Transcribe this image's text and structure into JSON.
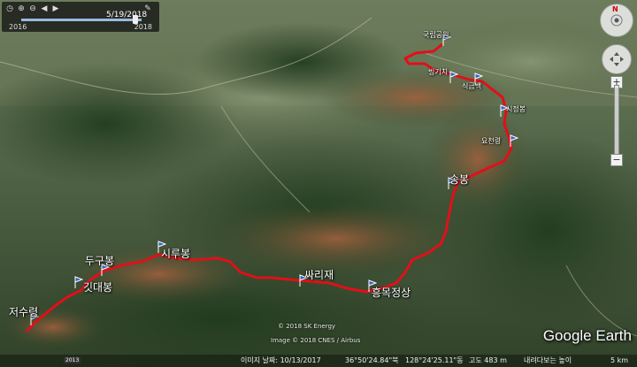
{
  "time_slider": {
    "date": "5/19/2018",
    "start_year": "2016",
    "end_year": "2018",
    "position_fraction": 0.93
  },
  "places": {
    "visitor_center": "국립공원",
    "seuggichi": "빙기치",
    "sigeuncheok": "식금백",
    "gapjabong": "시정봉",
    "obhyeongryeong": "요천령",
    "songbong": "송봉",
    "gittaebong": "깃대봉",
    "dugubong": "두구봉",
    "sirubong": "시루봉",
    "ssirije": "싸리재",
    "heungmokjeongsang": "흥목정상",
    "jeosuryeong": "저수령"
  },
  "watermarks": {
    "copyright1": "© 2018 SK Energy",
    "copyright2": "Image © 2018 CNES / Airbus",
    "logo": "Google Earth"
  },
  "status_bar": {
    "imagery_date": "이미지 날짜: 10/13/2017",
    "lat": "36°50'24.84\"북",
    "lon": "128°24'25.11\"동",
    "elevation": "고도  483 m",
    "eye_alt": "내려다보는 높이",
    "scale": "5 km",
    "year_badge": "2013"
  },
  "nav": {
    "north": "N"
  }
}
